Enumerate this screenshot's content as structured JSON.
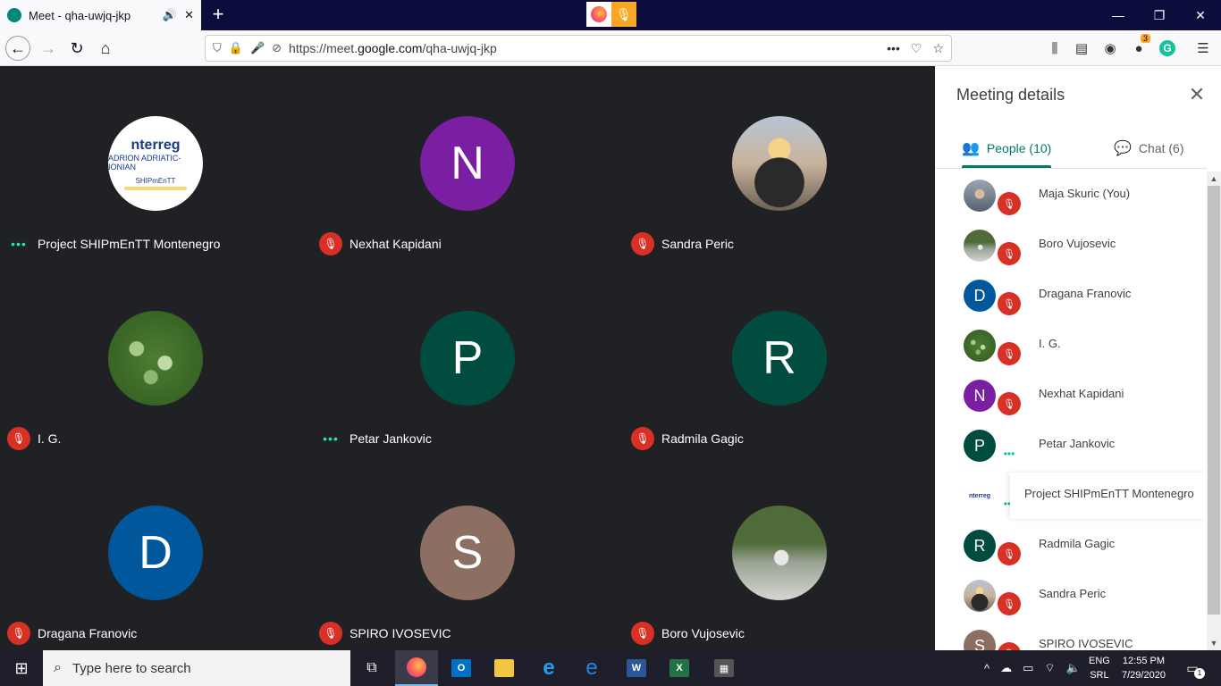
{
  "browser": {
    "tab_title": "Meet - qha-uwjq-jkp",
    "tab_audio_icon": "speaker-icon",
    "tab_close": "✕",
    "new_tab": "+",
    "url_prefix": "https://meet.",
    "url_domain": "google.com",
    "url_path": "/qha-uwjq-jkp",
    "url_more": "•••",
    "extension_badge": "3",
    "grammarly_letter": "G"
  },
  "grid": {
    "tiles": [
      {
        "name": "Project SHIPmEnTT Montenegro",
        "avatar": "logo",
        "status": "speaking"
      },
      {
        "name": "Nexhat Kapidani",
        "avatar": "N",
        "color": "#7b1fa2",
        "status": "muted"
      },
      {
        "name": "Sandra Peric",
        "avatar": "photo",
        "status": "muted"
      },
      {
        "name": "I. G.",
        "avatar": "photo",
        "status": "muted"
      },
      {
        "name": "Petar Jankovic",
        "avatar": "P",
        "color": "#004d40",
        "status": "speaking"
      },
      {
        "name": "Radmila Gagic",
        "avatar": "R",
        "color": "#004d40",
        "status": "muted"
      },
      {
        "name": "Dragana Franovic",
        "avatar": "D",
        "color": "#01579b",
        "status": "muted"
      },
      {
        "name": "SPIRO IVOSEVIC",
        "avatar": "S",
        "color": "#8d6e63",
        "status": "muted"
      },
      {
        "name": "Boro Vujosevic",
        "avatar": "photo",
        "status": "muted"
      }
    ],
    "logo": {
      "line1": "nterreg",
      "line2": "ADRION   ADRIATIC-IONIAN",
      "line3": "SHIPmEnTT"
    }
  },
  "panel": {
    "title": "Meeting details",
    "close": "✕",
    "tabs": [
      {
        "label": "People (10)",
        "icon": "people-icon"
      },
      {
        "label": "Chat (6)",
        "icon": "chat-icon"
      }
    ],
    "people": [
      {
        "name": "Maja Skuric (You)",
        "avatar": "photo",
        "status": "muted"
      },
      {
        "name": "Boro Vujosevic",
        "avatar": "photo",
        "status": "muted"
      },
      {
        "name": "Dragana Franovic",
        "avatar": "D",
        "color": "#01579b",
        "status": "muted"
      },
      {
        "name": "I. G.",
        "avatar": "photo",
        "status": "muted"
      },
      {
        "name": "Nexhat Kapidani",
        "avatar": "N",
        "color": "#7b1fa2",
        "status": "muted"
      },
      {
        "name": "Petar Jankovic",
        "avatar": "P",
        "color": "#004d40",
        "status": "speaking"
      },
      {
        "name": "Project SHIPmEnTT Montenegro",
        "avatar": "logo",
        "status": "speaking"
      },
      {
        "name": "Radmila Gagic",
        "avatar": "R",
        "color": "#004d40",
        "status": "muted"
      },
      {
        "name": "Sandra Peric",
        "avatar": "photo",
        "status": "muted"
      },
      {
        "name": "SPIRO IVOSEVIC",
        "avatar": "S",
        "color": "#8d6e63",
        "status": "muted"
      }
    ]
  },
  "taskbar": {
    "search_placeholder": "Type here to search",
    "lang_line1": "ENG",
    "lang_line2": "SRL",
    "time": "12:55 PM",
    "date": "7/29/2020",
    "notification_count": "1"
  }
}
